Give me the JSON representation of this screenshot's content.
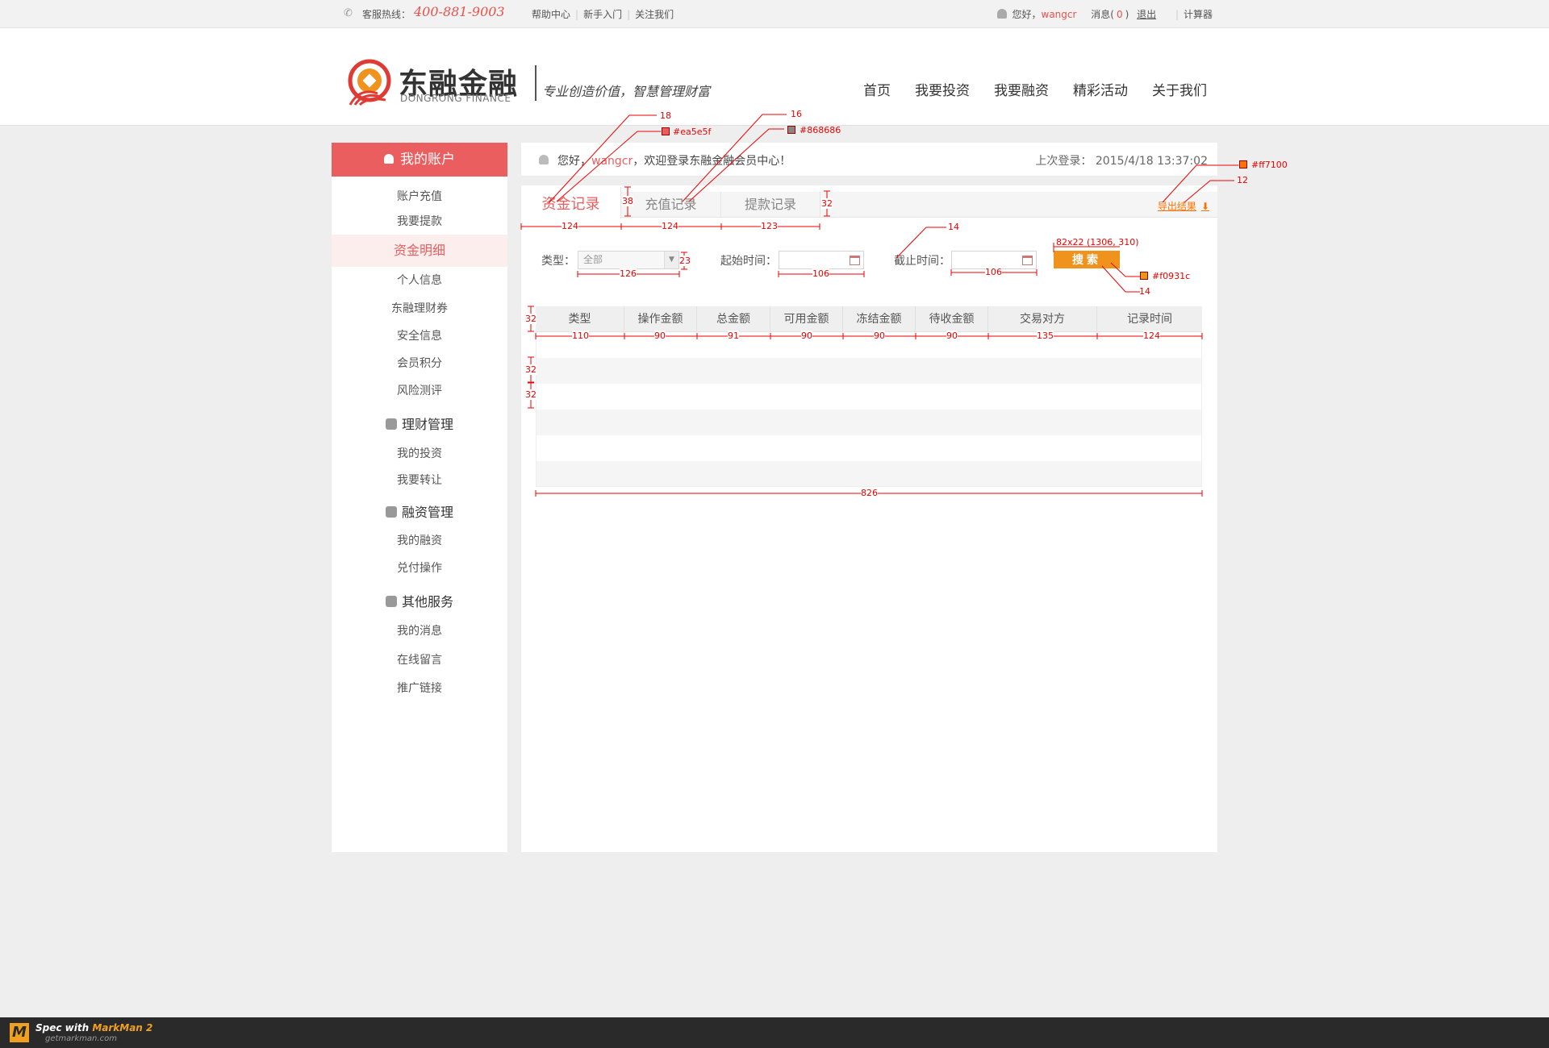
{
  "topbar": {
    "hotline_label": "客服热线：",
    "hotline_number": "400-881-9003",
    "links": [
      "帮助中心",
      "新手入门",
      "关注我们"
    ],
    "greeting_prefix": "您好，",
    "username": "wangcr",
    "messages_label": "消息(",
    "messages_count": "0",
    "messages_close": ")",
    "logout": "退出",
    "calculator": "计算器"
  },
  "header": {
    "logo_cn": "东融金融",
    "logo_en": "DONGRONG FINANCE",
    "slogan": "专业创造价值，智慧管理财富",
    "nav": [
      "首页",
      "我要投资",
      "我要融资",
      "精彩活动",
      "关于我们"
    ]
  },
  "sidebar": {
    "title": "我的账户",
    "account_items": [
      "账户充值",
      "我要提款",
      "资金明细",
      "个人信息",
      "东融理财券",
      "安全信息",
      "会员积分",
      "风险测评"
    ],
    "active_item": "资金明细",
    "groups": [
      {
        "title": "理财管理",
        "items": [
          "我的投资",
          "我要转让"
        ]
      },
      {
        "title": "融资管理",
        "items": [
          "我的融资",
          "兑付操作"
        ]
      },
      {
        "title": "其他服务",
        "items": [
          "我的消息",
          "在线留言",
          "推广链接"
        ]
      }
    ]
  },
  "welcome": {
    "prefix": "您好，",
    "username": "wangcr",
    "suffix": "，欢迎登录东融金融会员中心！",
    "last_login_label": "上次登录：",
    "last_login_time": "2015/4/18 13:37:02"
  },
  "tabs": [
    "资金记录",
    "充值记录",
    "提款记录"
  ],
  "export_label": "导出结果",
  "filters": {
    "type_label": "类型：",
    "type_value": "全部",
    "start_label": "起始时间：",
    "end_label": "截止时间：",
    "search_button": "搜索"
  },
  "table": {
    "columns": [
      "类型",
      "操作金额",
      "总金额",
      "可用金额",
      "冻结金额",
      "待收金额",
      "交易对方",
      "记录时间"
    ],
    "rows": []
  },
  "annotations": {
    "tab_font_active": "18",
    "tab_color_active": "#ea5e5f",
    "tab_font": "16",
    "tab_color": "#868686",
    "export_color": "#ff7100",
    "export_font": "12",
    "search_size": "82x22 (1306, 310)",
    "search_color": "#f0931c",
    "search_font": "14",
    "end_label_font": "14",
    "tab_height": "38",
    "tabbar_height": "32",
    "tab_widths": [
      "124",
      "124",
      "123"
    ],
    "select_width": "126",
    "select_height": "23",
    "date_widths": [
      "106",
      "106"
    ],
    "row_heights": [
      "32",
      "32",
      "32"
    ],
    "column_widths": [
      "110",
      "90",
      "91",
      "90",
      "90",
      "90",
      "135",
      "124"
    ],
    "table_width": "826"
  },
  "footer": {
    "spec_with": "Spec with",
    "markman": "MarkMan 2",
    "url": "getmarkman.com"
  },
  "colors": {
    "brand_red": "#ea5e5f",
    "orange": "#f0931c",
    "export_orange": "#ff7100",
    "gray_text": "#868686"
  }
}
